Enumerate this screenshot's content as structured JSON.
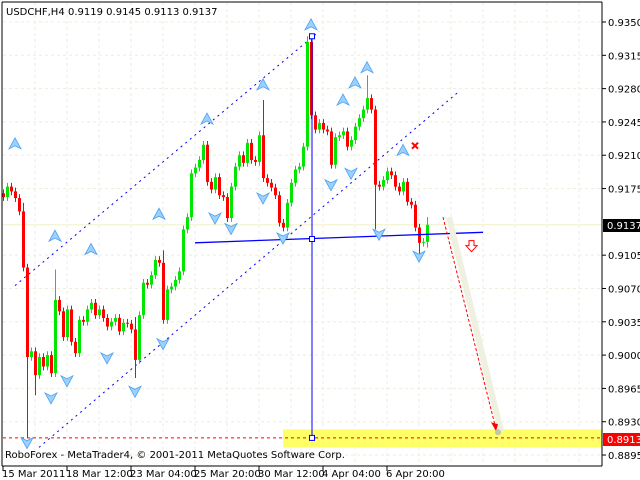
{
  "header": {
    "symbol": "USDCHF,H4",
    "ohlc_text": "0.9119 0.9145 0.9113 0.9137"
  },
  "footer": {
    "copyright": "RoboForex - MetaTrader4, © 2001-2011 MetaQuotes Software Corp."
  },
  "colors": {
    "bull": "#00e600",
    "bear": "#ff0000",
    "grid": "#eeeed8",
    "channel": "#0000ff",
    "fractal": "#4aa0f0",
    "zone": "#ffff66",
    "target": "#ff0000"
  },
  "chart_data": {
    "type": "candlestick",
    "title": "USDCHF,H4",
    "timeframe": "H4",
    "ylim": [
      0.8895,
      0.935
    ],
    "y_ticks": [
      "0.9350",
      "0.9315",
      "0.9280",
      "0.9245",
      "0.9210",
      "0.9175",
      "0.9105",
      "0.9070",
      "0.9035",
      "0.9000",
      "0.8965",
      "0.8930",
      "0.8895"
    ],
    "x_ticks": [
      "15 Mar 2011",
      "18 Mar 12:00",
      "23 Mar 04:00",
      "25 Mar 20:00",
      "30 Mar 12:00",
      "4 Apr 04:00",
      "6 Apr 20:00"
    ],
    "x_tick_bar_index": [
      0,
      16,
      32,
      48,
      64,
      80,
      96
    ],
    "first_open": 0.917,
    "closes": [
      0.9166,
      0.9177,
      0.9172,
      0.9165,
      0.9151,
      0.9092,
      0.8998,
      0.9004,
      0.8979,
      0.8998,
      0.8988,
      0.9,
      0.8981,
      0.9058,
      0.9046,
      0.9019,
      0.9048,
      0.9014,
      0.9002,
      0.9037,
      0.9035,
      0.9048,
      0.9055,
      0.9042,
      0.9048,
      0.9039,
      0.903,
      0.9035,
      0.9039,
      0.9025,
      0.9034,
      0.9033,
      0.9027,
      0.8995,
      0.9042,
      0.9076,
      0.9074,
      0.9084,
      0.91,
      0.9097,
      0.9037,
      0.9069,
      0.9072,
      0.9079,
      0.9088,
      0.9132,
      0.9145,
      0.9191,
      0.9197,
      0.9205,
      0.9221,
      0.9182,
      0.9174,
      0.9187,
      0.9168,
      0.9166,
      0.9144,
      0.9177,
      0.9198,
      0.921,
      0.9202,
      0.9223,
      0.9205,
      0.9203,
      0.9231,
      0.9186,
      0.9181,
      0.9176,
      0.9168,
      0.9139,
      0.9134,
      0.916,
      0.9181,
      0.9195,
      0.9198,
      0.9219,
      0.9329,
      0.9252,
      0.9237,
      0.9244,
      0.9237,
      0.9235,
      0.92,
      0.9229,
      0.9231,
      0.9235,
      0.9219,
      0.9226,
      0.924,
      0.9249,
      0.9258,
      0.927,
      0.9258,
      0.9179,
      0.9177,
      0.9184,
      0.9193,
      0.9189,
      0.9177,
      0.9172,
      0.9182,
      0.9161,
      0.9158,
      0.9134,
      0.9118,
      0.9119,
      0.9137
    ],
    "high_overrides": {
      "5": 0.916,
      "13": 0.909,
      "33": 0.904,
      "40": 0.911,
      "65": 0.9268,
      "76": 0.9335,
      "91": 0.9294,
      "106": 0.9145
    },
    "low_overrides": {
      "6": 0.8913,
      "8": 0.8958,
      "33": 0.8976,
      "93": 0.9132,
      "104": 0.91,
      "106": 0.9113
    },
    "current_price": "0.9137",
    "target_price": "0.8913",
    "neckline": {
      "from": [
        48,
        0.9118
      ],
      "to": [
        120,
        0.9129
      ]
    },
    "channel_upper": {
      "from": [
        3,
        0.9073
      ],
      "to": [
        79,
        0.934
      ]
    },
    "channel_lower": {
      "from": [
        9,
        0.8903
      ],
      "to": [
        114,
        0.9277
      ]
    },
    "vertical_marker": {
      "bar": 77,
      "prices": [
        0.9335,
        0.9122,
        0.8913
      ]
    },
    "forecast_arrow": {
      "from": [
        110,
        0.9145
      ],
      "to": [
        123,
        0.892
      ]
    },
    "target_zone": {
      "from_bar": 70,
      "price_top": 0.8922,
      "price_bottom": 0.8903
    },
    "sell_arrow": {
      "bar": 117,
      "price": 0.9115
    },
    "cross_mark": {
      "bar": 103,
      "price": 0.922
    },
    "fractals_up": [
      [
        3,
        0.9222
      ],
      [
        13,
        0.9125
      ],
      [
        22,
        0.9111
      ],
      [
        39,
        0.9148
      ],
      [
        51,
        0.9248
      ],
      [
        65,
        0.9284
      ],
      [
        77,
        0.9347
      ],
      [
        85,
        0.9268
      ],
      [
        88,
        0.9286
      ],
      [
        91,
        0.9302
      ],
      [
        100,
        0.9215
      ]
    ],
    "fractals_down": [
      [
        6,
        0.8908
      ],
      [
        12,
        0.8955
      ],
      [
        16,
        0.8973
      ],
      [
        26,
        0.8997
      ],
      [
        33,
        0.8962
      ],
      [
        40,
        0.9012
      ],
      [
        53,
        0.9144
      ],
      [
        57,
        0.9133
      ],
      [
        65,
        0.9165
      ],
      [
        70,
        0.9123
      ],
      [
        82,
        0.9179
      ],
      [
        87,
        0.9191
      ],
      [
        94,
        0.9127
      ],
      [
        104,
        0.9104
      ]
    ]
  }
}
